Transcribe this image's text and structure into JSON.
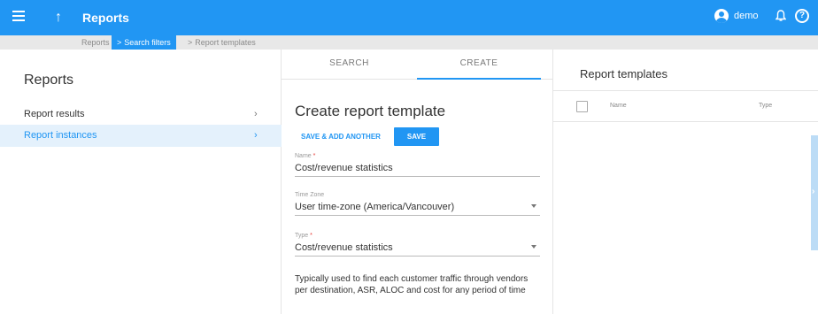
{
  "header": {
    "title": "Reports",
    "user": "demo",
    "help_glyph": "?",
    "up_glyph": "↑",
    "bell_glyph": "♫",
    "colors": {
      "primary": "#2196f3"
    }
  },
  "breadcrumb": {
    "items": [
      {
        "label": "Reports",
        "active": false
      },
      {
        "label": "Search filters",
        "active": true
      },
      {
        "label": "Report templates",
        "active": false
      }
    ],
    "separator": ">"
  },
  "sidebar": {
    "title": "Reports",
    "items": [
      {
        "label": "Report results",
        "selected": false
      },
      {
        "label": "Report instances",
        "selected": true
      }
    ],
    "chevron": "›"
  },
  "form": {
    "tabs": [
      {
        "label": "SEARCH",
        "active": false
      },
      {
        "label": "CREATE",
        "active": true
      }
    ],
    "title": "Create report template",
    "save_add_label": "SAVE & ADD ANOTHER",
    "save_label": "SAVE",
    "fields": {
      "name": {
        "label": "Name",
        "required": "*",
        "value": "Cost/revenue statistics"
      },
      "timezone": {
        "label": "Time Zone",
        "value": "User time-zone (America/Vancouver)"
      },
      "type": {
        "label": "Type",
        "required": "*",
        "value": "Cost/revenue statistics"
      }
    },
    "description": "Typically used to find each customer traffic through vendors per destination, ASR, ALOC and cost for any period of time"
  },
  "templates": {
    "title": "Report templates",
    "columns": [
      "Name",
      "Type"
    ]
  },
  "icons": [
    "menu-icon",
    "arrow-up-icon",
    "account-icon",
    "bell-icon",
    "help-icon",
    "chevron-right-icon",
    "dropdown-caret-icon",
    "checkbox-icon"
  ]
}
